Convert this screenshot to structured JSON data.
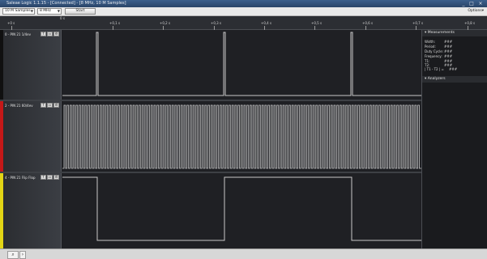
{
  "window": {
    "title": "Saleae Logic 1.1.15 - [Connected] - [8 MHz, 10 M Samples]",
    "minimize": "_",
    "maximize": "□",
    "close": "×"
  },
  "toolbar": {
    "samples": "10 M Samples",
    "rate": "8 MHz",
    "start_label": "Start",
    "options_label": "Options▾"
  },
  "timeline": {
    "origin": "0 s",
    "ticks": [
      "+0 s",
      "+0,1 s",
      "+0,2 s",
      "+0,3 s",
      "+0,4 s",
      "+0,5 s",
      "+0,6 s",
      "+0,7 s",
      "+0,8 s"
    ]
  },
  "channels": [
    {
      "label": "0 - PIN 21 1/4ev",
      "color": "#101010",
      "buttons": [
        "f",
        "▭",
        "⚙"
      ]
    },
    {
      "label": "2 - PIN 21 60/4ev",
      "color": "#c41818",
      "buttons": [
        "f",
        "▭",
        "⚙"
      ]
    },
    {
      "label": "4 - PIN 21 Flip Flop",
      "color": "#e2d515",
      "buttons": [
        "f",
        "▭",
        "⚙"
      ]
    }
  ],
  "measurements": {
    "header": "Measurements",
    "rows": [
      {
        "label": "Width:",
        "value": "###"
      },
      {
        "label": "Period:",
        "value": "###"
      },
      {
        "label": "Duty Cycle:",
        "value": "###"
      },
      {
        "label": "Frequency:",
        "value": "###"
      },
      {
        "label": "T1:",
        "value": "###"
      },
      {
        "label": "T2:",
        "value": "###"
      },
      {
        "label": "| T1 - T2 | =",
        "value": "###"
      }
    ]
  },
  "analyzers": {
    "header": "Analyzers"
  },
  "statusbar": {
    "search_icon": "magnifier",
    "tab_icon": "tab"
  },
  "colors": {
    "signal": "#c8c8c8",
    "background": "#1e1f22"
  }
}
